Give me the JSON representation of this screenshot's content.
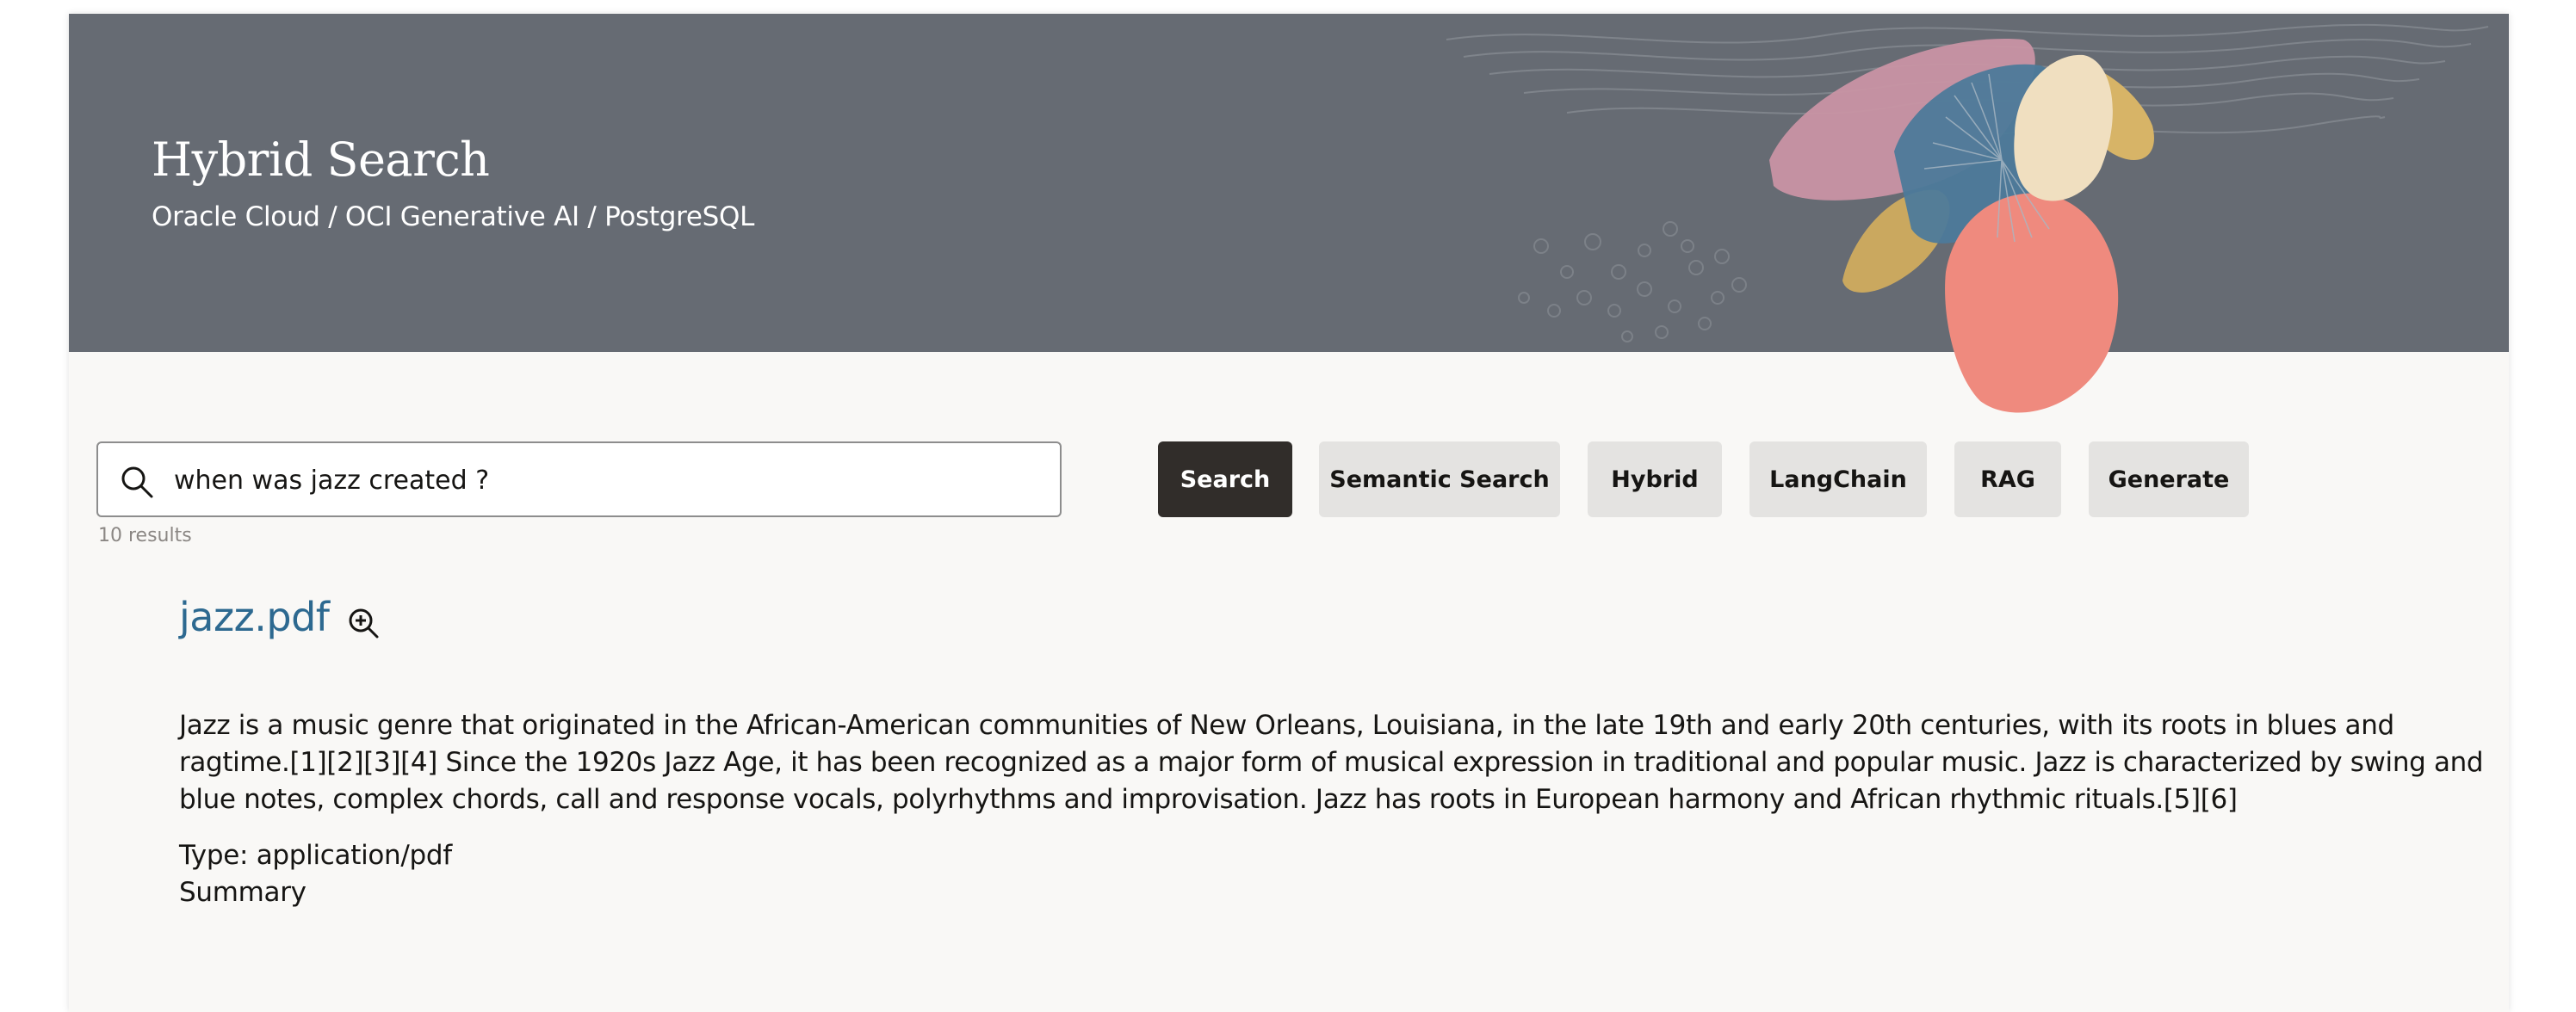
{
  "header": {
    "title": "Hybrid Search",
    "subtitle": "Oracle Cloud / OCI Generative AI / PostgreSQL"
  },
  "search": {
    "value": "when was jazz created ?",
    "placeholder": "",
    "icon": "search-icon"
  },
  "buttons": {
    "search": "Search",
    "semantic": "Semantic Search",
    "hybrid": "Hybrid",
    "langchain": "LangChain",
    "rag": "RAG",
    "generate": "Generate"
  },
  "results": {
    "count_label": "10 results",
    "items": [
      {
        "title": "jazz.pdf",
        "icon": "zoom-in-icon",
        "body": "Jazz is a music genre that originated in the African-American communities of New Orleans, Louisiana, in the late 19th and early 20th centuries, with its roots in blues and ragtime.[1][2][3][4] Since the 1920s Jazz Age, it has been recognized as a major form of musical expression in traditional and popular music. Jazz is characterized by swing and blue notes, complex chords, call and response vocals, polyrhythms and improvisation. Jazz has roots in European harmony and African rhythmic rituals.[5][6]",
        "type_label": "Type: application/pdf",
        "summary_label": "Summary"
      }
    ]
  },
  "colors": {
    "banner": "#666b73",
    "primary_button": "#312d2a",
    "secondary_button": "#e4e3e1",
    "link": "#2d6990"
  }
}
